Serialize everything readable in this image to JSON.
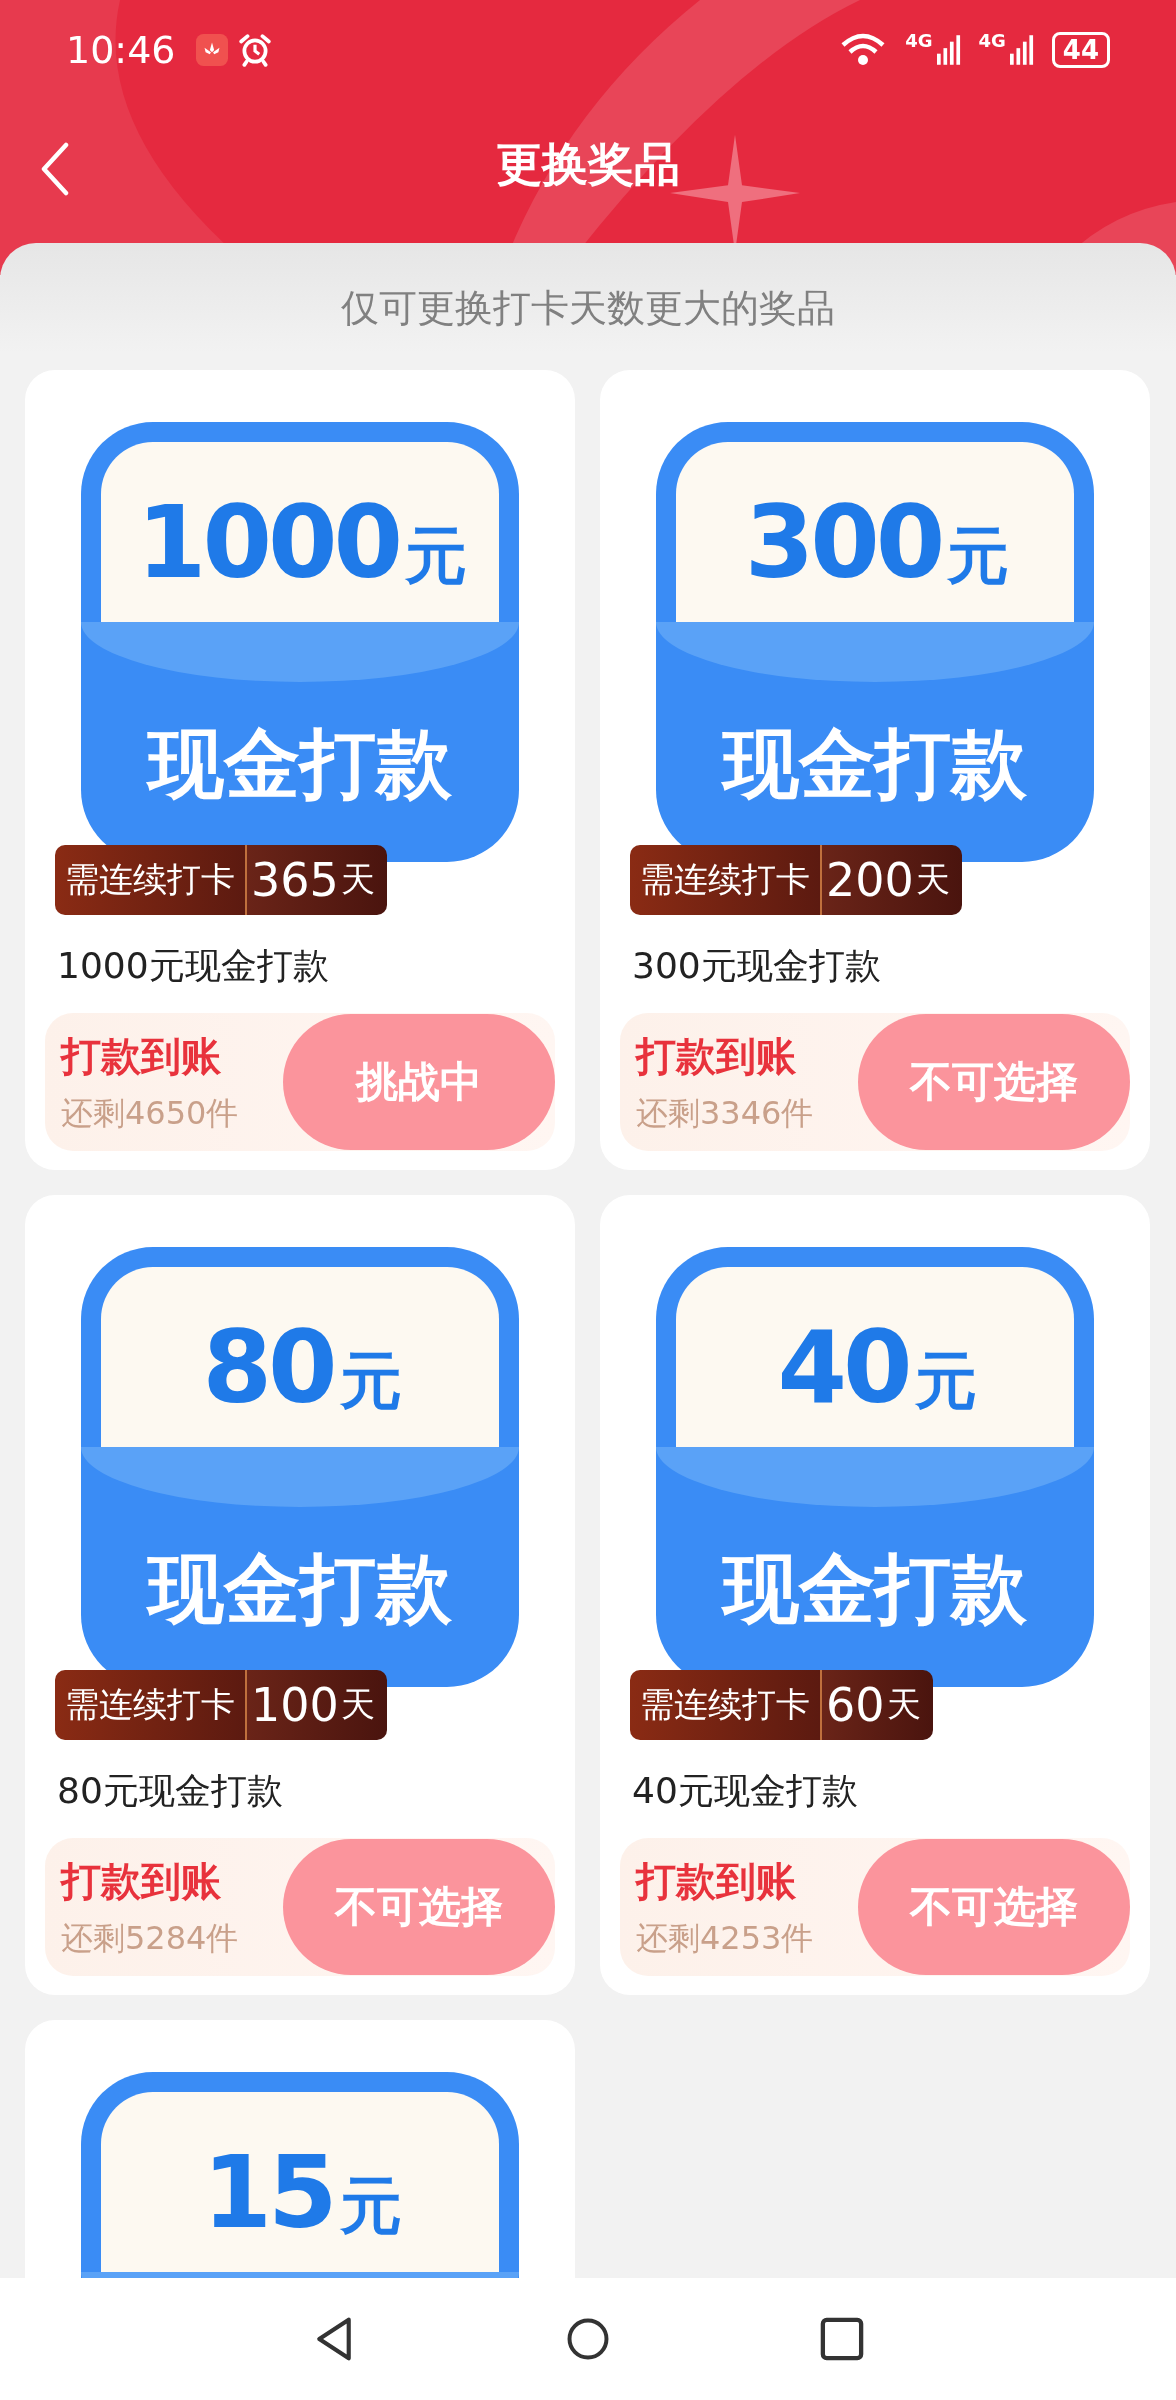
{
  "status_bar": {
    "time": "10:46",
    "network_1": "4G",
    "network_2": "4G",
    "battery": "44"
  },
  "header": {
    "title": "更换奖品"
  },
  "notice": "仅可更换打卡天数更大的奖品",
  "prizes": [
    {
      "amount": "1000",
      "unit": "元",
      "label": "现金打款",
      "badge_label": "需连续打卡",
      "badge_days": "365",
      "badge_unit": "天",
      "title": "1000元现金打款",
      "payout": "打款到账",
      "stock": "还剩4650件",
      "button": "挑战中"
    },
    {
      "amount": "300",
      "unit": "元",
      "label": "现金打款",
      "badge_label": "需连续打卡",
      "badge_days": "200",
      "badge_unit": "天",
      "title": "300元现金打款",
      "payout": "打款到账",
      "stock": "还剩3346件",
      "button": "不可选择"
    },
    {
      "amount": "80",
      "unit": "元",
      "label": "现金打款",
      "badge_label": "需连续打卡",
      "badge_days": "100",
      "badge_unit": "天",
      "title": "80元现金打款",
      "payout": "打款到账",
      "stock": "还剩5284件",
      "button": "不可选择"
    },
    {
      "amount": "40",
      "unit": "元",
      "label": "现金打款",
      "badge_label": "需连续打卡",
      "badge_days": "60",
      "badge_unit": "天",
      "title": "40元现金打款",
      "payout": "打款到账",
      "stock": "还剩4253件",
      "button": "不可选择"
    },
    {
      "amount": "15",
      "unit": "元"
    }
  ]
}
